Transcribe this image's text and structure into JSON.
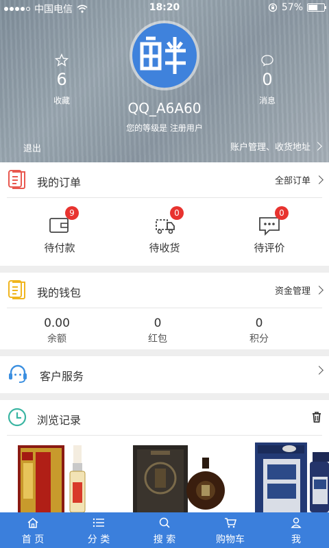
{
  "status_bar": {
    "carrier": "中国电信",
    "time": "18:20",
    "battery": "57%",
    "battery_level": 0.57
  },
  "profile": {
    "favorites": {
      "count": "6",
      "label": "收藏"
    },
    "messages": {
      "count": "0",
      "label": "消息"
    },
    "username": "QQ_A6A60",
    "level_text": "您的等级是 注册用户",
    "logout_label": "退出",
    "account_link": "账户管理、收货地址"
  },
  "orders": {
    "title": "我的订单",
    "all_label": "全部订单",
    "items": [
      {
        "label": "待付款",
        "badge": "9"
      },
      {
        "label": "待收货",
        "badge": "0"
      },
      {
        "label": "待评价",
        "badge": "0"
      }
    ]
  },
  "wallet": {
    "title": "我的钱包",
    "manage_label": "资金管理",
    "items": [
      {
        "value": "0.00",
        "label": "余额"
      },
      {
        "value": "0",
        "label": "红包"
      },
      {
        "value": "0",
        "label": "积分"
      }
    ]
  },
  "service": {
    "title": "客户服务"
  },
  "history": {
    "title": "浏览记录"
  },
  "tabbar": {
    "items": [
      "首 页",
      "分 类",
      "搜 索",
      "购物车",
      "我"
    ]
  },
  "colors": {
    "accent": "#3b7fdc",
    "badge": "#e8332f"
  }
}
